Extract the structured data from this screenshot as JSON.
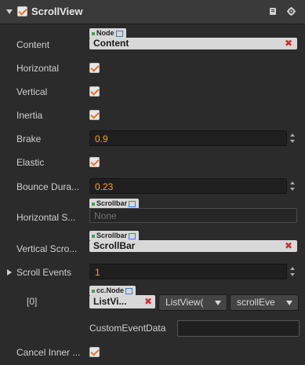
{
  "header": {
    "title": "ScrollView",
    "enabled": true,
    "help_icon": "book-icon",
    "settings_icon": "gear-icon"
  },
  "fields": {
    "content": {
      "label": "Content",
      "type_tag": "Node",
      "value": "Content"
    },
    "horizontal": {
      "label": "Horizontal",
      "checked": true
    },
    "vertical": {
      "label": "Vertical",
      "checked": true
    },
    "inertia": {
      "label": "Inertia",
      "checked": true
    },
    "brake": {
      "label": "Brake",
      "value": "0.9"
    },
    "elastic": {
      "label": "Elastic",
      "checked": true
    },
    "bounce_duration": {
      "label": "Bounce Dura...",
      "value": "0.23"
    },
    "horizontal_scrollbar": {
      "label": "Horizontal S...",
      "type_tag": "Scrollbar",
      "value": "None"
    },
    "vertical_scrollbar": {
      "label": "Vertical Scro...",
      "type_tag": "Scrollbar",
      "value": "ScrollBar"
    },
    "scroll_events": {
      "label": "Scroll Events",
      "count": "1",
      "items": [
        {
          "index_label": "[0]",
          "type_tag": "cc.Node",
          "target": "ListVi...",
          "component": "ListView(",
          "handler": "scrollEve",
          "custom_label": "CustomEventData",
          "custom_value": ""
        }
      ]
    },
    "cancel_inner": {
      "label": "Cancel Inner ...",
      "checked": true
    }
  },
  "colors": {
    "number_text": "#f0a030",
    "checkmark": "#e8732b",
    "clear_x": "#d03030",
    "background": "#2b2b2b"
  }
}
